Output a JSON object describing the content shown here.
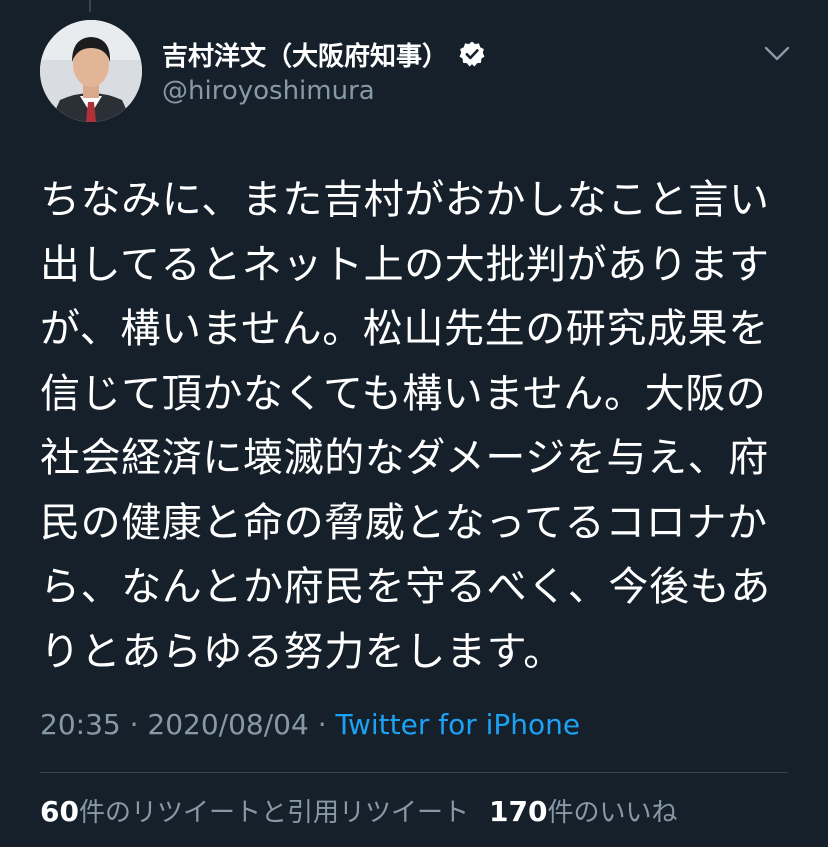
{
  "author": {
    "display_name": "吉村洋文（大阪府知事）",
    "handle": "@hiroyoshimura",
    "verified": true
  },
  "tweet": {
    "text": "ちなみに、また吉村がおかしなこと言い\n出してるとネット上の大批判がありますが、構いません。松山先生の研究成果を\n信じて頂かなくても構いません。大阪の\n社会経済に壊滅的なダメージを与え、府\n民の健康と命の脅威となってるコロナか\nら、なんとか府民を守るべく、今後もあ\nりとあらゆる努力をします。",
    "time": "20:35",
    "date": "2020/08/04",
    "separator": " · ",
    "source": "Twitter for iPhone"
  },
  "stats": {
    "retweets_count": "60",
    "retweets_label": "件のリツイートと引用リツイート",
    "likes_count": "170",
    "likes_label": "件のいいね"
  },
  "icons": [
    "verified-badge-icon",
    "chevron-down-icon"
  ],
  "colors": {
    "background": "#15202b",
    "text": "#ffffff",
    "secondary": "#8899a6",
    "link": "#1da1f2",
    "divider": "#38444d"
  }
}
